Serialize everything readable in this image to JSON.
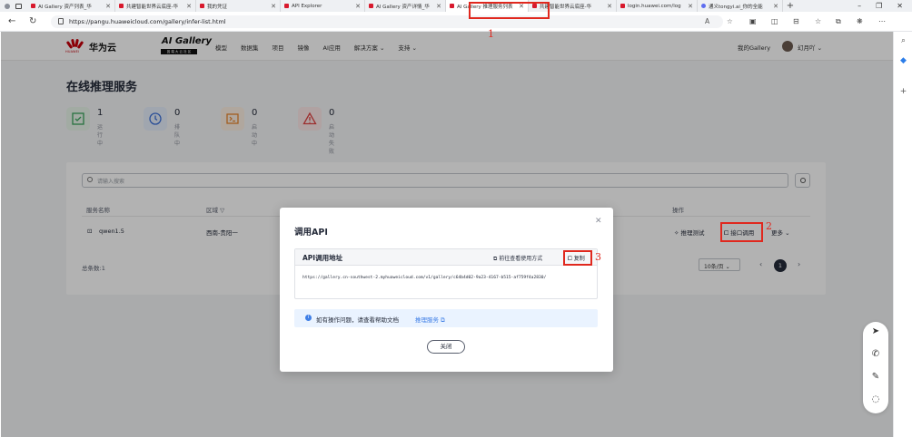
{
  "browser": {
    "tabs": [
      {
        "label": "AI Gallery 资产列表_华",
        "fav": "red"
      },
      {
        "label": "共建智能世界云底座-华",
        "fav": "red"
      },
      {
        "label": "我的凭证",
        "fav": "red"
      },
      {
        "label": "API Explorer",
        "fav": "red"
      },
      {
        "label": "AI Gallery 资产详情_华",
        "fav": "red"
      },
      {
        "label": "AI Gallery 推理服务列表",
        "fav": "red"
      },
      {
        "label": "共建智能世界云底座-华",
        "fav": "red"
      },
      {
        "label": "login.huawei.com/log",
        "fav": "red"
      },
      {
        "label": "通义tongyi.ai_你的全能",
        "fav": "blue"
      }
    ],
    "url": "https://pangu.huaweicloud.com/gallery/infer-list.html"
  },
  "header": {
    "logo_sub": "HUAWEI",
    "brand": "华为云",
    "gallery": "AI Gallery",
    "gallery_sub": "因 端 大 云 社 区",
    "menu": [
      "模型",
      "数据集",
      "项目",
      "镜像",
      "AI应用",
      "解决方案 ⌄",
      "支持 ⌄"
    ],
    "my_gallery": "我的Gallery",
    "user": "幻月吖 ⌄"
  },
  "page": {
    "title": "在线推理服务",
    "stats": [
      {
        "num": "1",
        "label": "运行中",
        "color": "#e9f5ea",
        "icon": "check-icon"
      },
      {
        "num": "0",
        "label": "排队中",
        "color": "#e6eefb",
        "icon": "clock-icon"
      },
      {
        "num": "0",
        "label": "启动中",
        "color": "#fdefe3",
        "icon": "terminal-icon"
      },
      {
        "num": "0",
        "label": "启动失败",
        "color": "#fce8e8",
        "icon": "warning-icon"
      }
    ],
    "search_placeholder": "请输入搜索",
    "columns": {
      "name": "服务名称",
      "region": "区域 ▽",
      "ops": "操作"
    },
    "row": {
      "name": "qwen1.5",
      "region": "西南-贵阳一",
      "op_test": "推理测试",
      "op_api": "接口调用",
      "op_more": "更多 ⌄"
    },
    "total": "总条数:1",
    "page_size": "10条/页 ⌄",
    "current_page": "1"
  },
  "dialog": {
    "title": "调用API",
    "api_label": "API调用地址",
    "goto_label": "前往查看使用方式",
    "copy_label": "复制",
    "api_url": "https://gallery.cn-southwest-2.myhuaweicloud.com/v1/gallery/c64b4d02-9a23-4167-b515-af759f4a2830/",
    "tip_text": "如有操作问题，请查看帮助文档",
    "tip_link": "推理服务 ⧉",
    "close_label": "关闭"
  },
  "annotations": {
    "n1": "1",
    "n2": "2",
    "n3": "3"
  }
}
